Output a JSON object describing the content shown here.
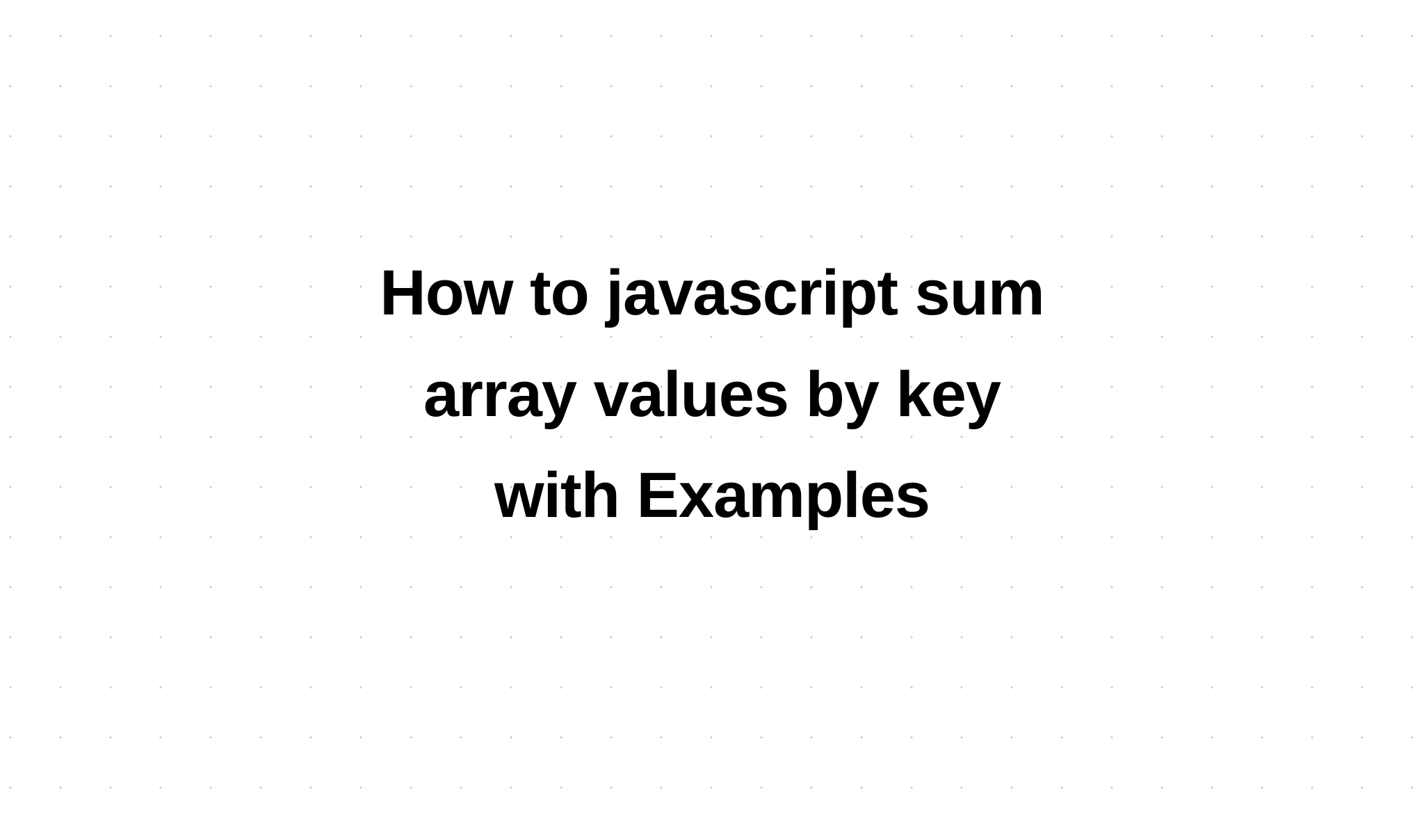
{
  "main": {
    "title": "How to javascript sum array values by key with Examples"
  }
}
